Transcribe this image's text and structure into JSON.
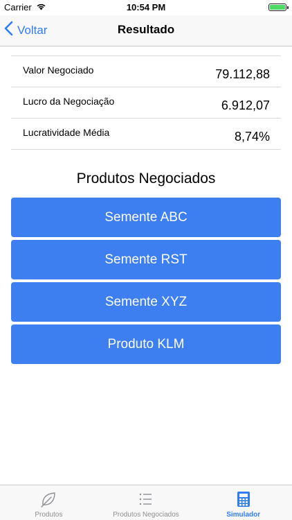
{
  "status_bar": {
    "carrier": "Carrier",
    "time": "10:54 PM"
  },
  "nav": {
    "back_label": "Voltar",
    "title": "Resultado"
  },
  "summary": [
    {
      "label": "Valor Negociado",
      "value": "79.112,88"
    },
    {
      "label": "Lucro da Negociação",
      "value": "6.912,07"
    },
    {
      "label": "Lucratividade Média",
      "value": "8,74%"
    }
  ],
  "products_section": {
    "title": "Produtos Negociados",
    "items": [
      {
        "label": "Semente ABC"
      },
      {
        "label": "Semente RST"
      },
      {
        "label": "Semente XYZ"
      },
      {
        "label": "Produto KLM"
      }
    ]
  },
  "tab_bar": {
    "tabs": [
      {
        "label": "Produtos",
        "icon": "leaf-icon"
      },
      {
        "label": "Produtos Negociados",
        "icon": "list-icon"
      },
      {
        "label": "Simulador",
        "icon": "calculator-icon"
      }
    ],
    "active": "Simulador"
  },
  "colors": {
    "accent": "#2f7cf6",
    "button": "#3d7ff0",
    "battery": "#4cd964"
  }
}
